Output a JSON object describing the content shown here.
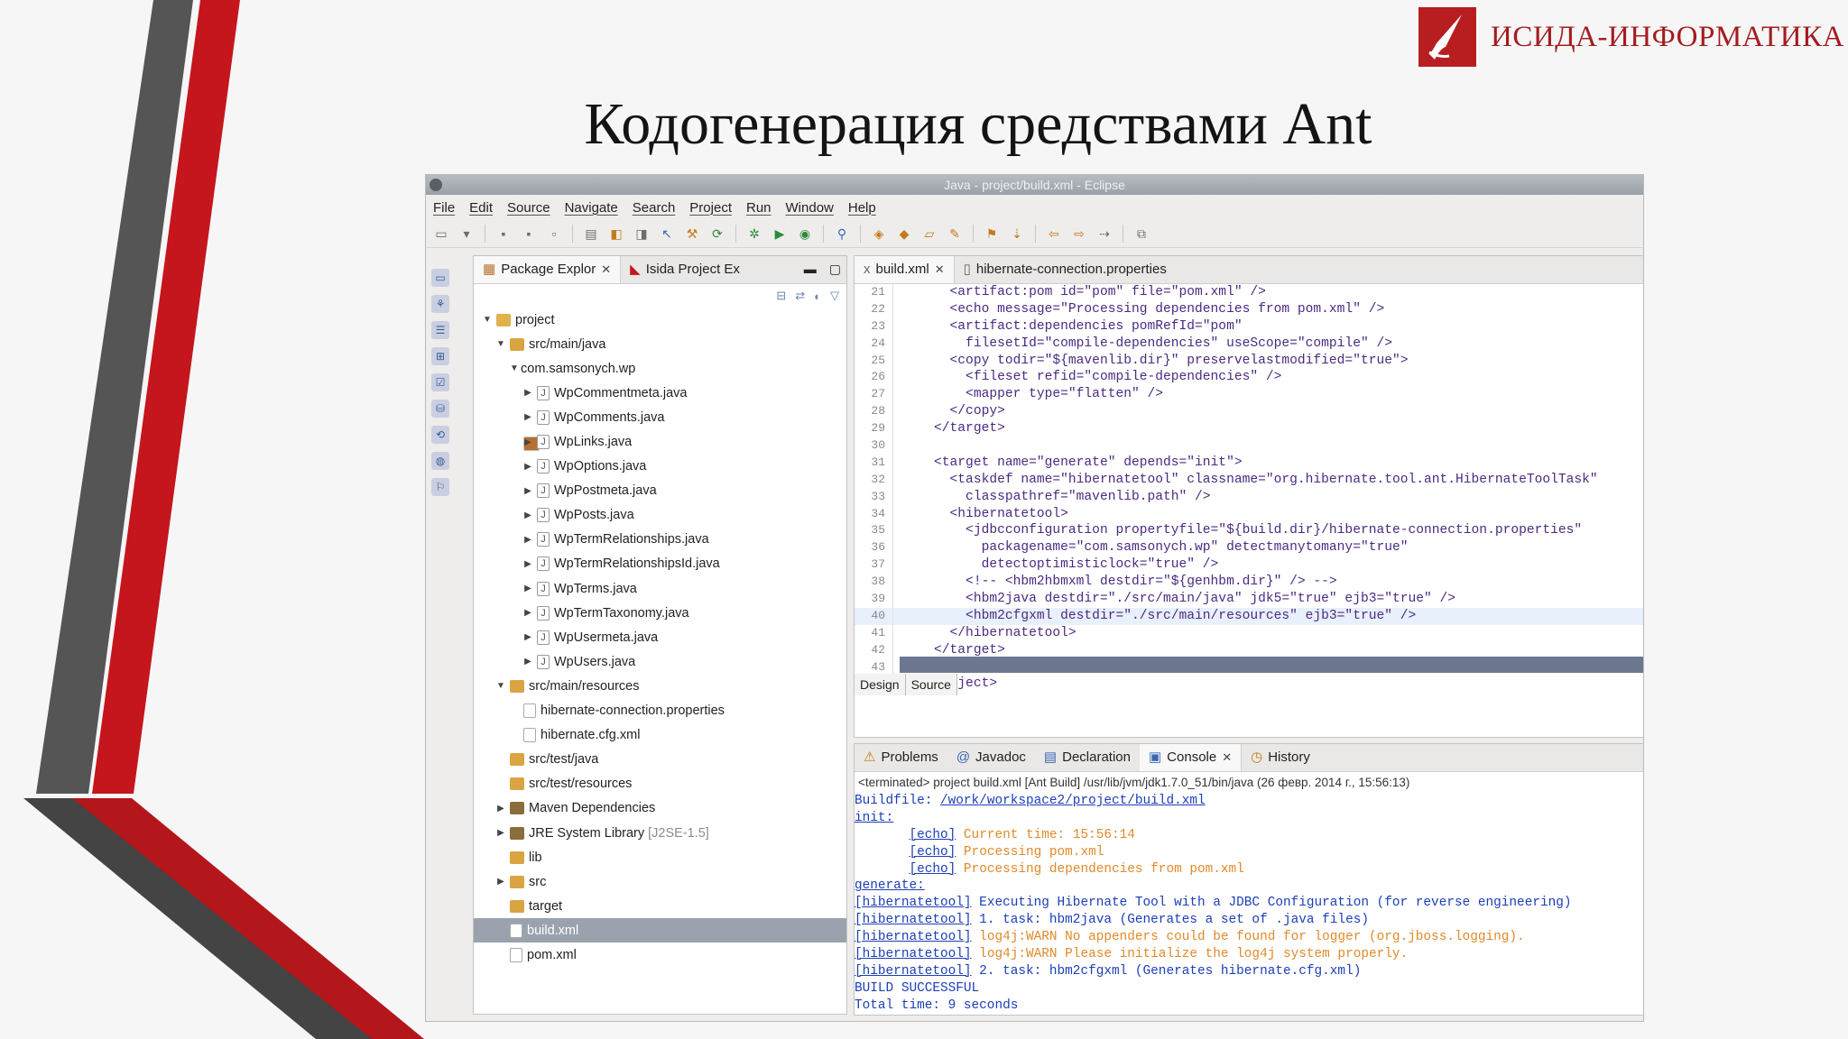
{
  "brand": {
    "name": "ИСИДА-ИНФОРМАТИКА",
    "color": "#a21d1f"
  },
  "slide": {
    "title": "Кодогенерация средствами Ant"
  },
  "window": {
    "title": "Java - project/build.xml - Eclipse",
    "menu": [
      "File",
      "Edit",
      "Source",
      "Navigate",
      "Search",
      "Project",
      "Run",
      "Window",
      "Help"
    ]
  },
  "package_explorer": {
    "tabs": [
      "Package Explor",
      "Isida Project Ex"
    ],
    "tree": [
      {
        "label": "project",
        "level": 0,
        "arrow": "▼",
        "icon": "project"
      },
      {
        "label": "src/main/java",
        "level": 1,
        "arrow": "▼",
        "icon": "folder"
      },
      {
        "label": "com.samsonych.wp",
        "level": 2,
        "arrow": "▼",
        "icon": "package"
      },
      {
        "label": "WpCommentmeta.java",
        "level": 3,
        "arrow": "▶",
        "icon": "java"
      },
      {
        "label": "WpComments.java",
        "level": 3,
        "arrow": "▶",
        "icon": "java"
      },
      {
        "label": "WpLinks.java",
        "level": 3,
        "arrow": "▶",
        "icon": "java"
      },
      {
        "label": "WpOptions.java",
        "level": 3,
        "arrow": "▶",
        "icon": "java"
      },
      {
        "label": "WpPostmeta.java",
        "level": 3,
        "arrow": "▶",
        "icon": "java"
      },
      {
        "label": "WpPosts.java",
        "level": 3,
        "arrow": "▶",
        "icon": "java"
      },
      {
        "label": "WpTermRelationships.java",
        "level": 3,
        "arrow": "▶",
        "icon": "java"
      },
      {
        "label": "WpTermRelationshipsId.java",
        "level": 3,
        "arrow": "▶",
        "icon": "java"
      },
      {
        "label": "WpTerms.java",
        "level": 3,
        "arrow": "▶",
        "icon": "java"
      },
      {
        "label": "WpTermTaxonomy.java",
        "level": 3,
        "arrow": "▶",
        "icon": "java"
      },
      {
        "label": "WpUsermeta.java",
        "level": 3,
        "arrow": "▶",
        "icon": "java"
      },
      {
        "label": "WpUsers.java",
        "level": 3,
        "arrow": "▶",
        "icon": "java"
      },
      {
        "label": "src/main/resources",
        "level": 1,
        "arrow": "▼",
        "icon": "folder"
      },
      {
        "label": "hibernate-connection.properties",
        "level": 2,
        "arrow": "",
        "icon": "file"
      },
      {
        "label": "hibernate.cfg.xml",
        "level": 2,
        "arrow": "",
        "icon": "file"
      },
      {
        "label": "src/test/java",
        "level": 1,
        "arrow": "",
        "icon": "folder"
      },
      {
        "label": "src/test/resources",
        "level": 1,
        "arrow": "",
        "icon": "folder"
      },
      {
        "label": "Maven Dependencies",
        "level": 1,
        "arrow": "▶",
        "icon": "lib"
      },
      {
        "label": "JRE System Library",
        "suffix": "[J2SE-1.5]",
        "level": 1,
        "arrow": "▶",
        "icon": "lib"
      },
      {
        "label": "lib",
        "level": 1,
        "arrow": "",
        "icon": "folder"
      },
      {
        "label": "src",
        "level": 1,
        "arrow": "▶",
        "icon": "folder"
      },
      {
        "label": "target",
        "level": 1,
        "arrow": "",
        "icon": "folder"
      },
      {
        "label": "build.xml",
        "level": 1,
        "arrow": "",
        "icon": "file",
        "selected": true
      },
      {
        "label": "pom.xml",
        "level": 1,
        "arrow": "",
        "icon": "file"
      }
    ]
  },
  "editor": {
    "tabs": [
      "build.xml",
      "hibernate-connection.properties"
    ],
    "bottom_tabs": [
      "Design",
      "Source"
    ],
    "lines": [
      {
        "n": "21",
        "text": "      <artifact:pom id=\"pom\" file=\"pom.xml\" />"
      },
      {
        "n": "22",
        "text": "      <echo message=\"Processing dependencies from pom.xml\" />"
      },
      {
        "n": "23",
        "text": "      <artifact:dependencies pomRefId=\"pom\""
      },
      {
        "n": "24",
        "text": "        filesetId=\"compile-dependencies\" useScope=\"compile\" />"
      },
      {
        "n": "25",
        "text": "      <copy todir=\"${mavenlib.dir}\" preservelastmodified=\"true\">"
      },
      {
        "n": "26",
        "text": "        <fileset refid=\"compile-dependencies\" />"
      },
      {
        "n": "27",
        "text": "        <mapper type=\"flatten\" />"
      },
      {
        "n": "28",
        "text": "      </copy>"
      },
      {
        "n": "29",
        "text": "    </target>"
      },
      {
        "n": "30",
        "text": ""
      },
      {
        "n": "31",
        "text": "    <target name=\"generate\" depends=\"init\">"
      },
      {
        "n": "32",
        "text": "      <taskdef name=\"hibernatetool\" classname=\"org.hibernate.tool.ant.HibernateToolTask\""
      },
      {
        "n": "33",
        "text": "        classpathref=\"mavenlib.path\" />"
      },
      {
        "n": "34",
        "text": "      <hibernatetool>"
      },
      {
        "n": "35",
        "text": "        <jdbcconfiguration propertyfile=\"${build.dir}/hibernate-connection.properties\""
      },
      {
        "n": "36",
        "text": "          packagename=\"com.samsonych.wp\" detectmanytomany=\"true\""
      },
      {
        "n": "37",
        "text": "          detectoptimisticlock=\"true\" />"
      },
      {
        "n": "38",
        "text": "        <!-- <hbm2hbmxml destdir=\"${genhbm.dir}\" /> -->"
      },
      {
        "n": "39",
        "text": "        <hbm2java destdir=\"./src/main/java\" jdk5=\"true\" ejb3=\"true\" />"
      },
      {
        "n": "40",
        "text": "        <hbm2cfgxml destdir=\"./src/main/resources\" ejb3=\"true\" />"
      },
      {
        "n": "41",
        "text": "      </hibernatetool>"
      },
      {
        "n": "42",
        "text": "    </target>"
      },
      {
        "n": "43",
        "text": ""
      },
      {
        "n": "44",
        "text": "  </project>"
      }
    ]
  },
  "console": {
    "tabs": [
      "Problems",
      "Javadoc",
      "Declaration",
      "Console",
      "History"
    ],
    "terminated": "<terminated> project build.xml [Ant Build] /usr/lib/jvm/jdk1.7.0_51/bin/java (26 февр. 2014 г., 15:56:13)",
    "lines": [
      {
        "prefix": "Buildfile: ",
        "link": "/work/workspace2/project/build.xml",
        "text": "",
        "color": "blue"
      },
      {
        "prefix": "",
        "link": "init:",
        "text": "",
        "color": "blue"
      },
      {
        "prefix": "       ",
        "link": "[echo]",
        "text": " Current time: 15:56:14",
        "color": "orange"
      },
      {
        "prefix": "       ",
        "link": "[echo]",
        "text": " Processing pom.xml",
        "color": "orange"
      },
      {
        "prefix": "       ",
        "link": "[echo]",
        "text": " Processing dependencies from pom.xml",
        "color": "orange"
      },
      {
        "prefix": "",
        "link": "generate:",
        "text": "",
        "color": "blue"
      },
      {
        "prefix": "",
        "link": "[hibernatetool]",
        "text": " Executing Hibernate Tool with a JDBC Configuration (for reverse engineering)",
        "color": "blue"
      },
      {
        "prefix": "",
        "link": "[hibernatetool]",
        "text": " 1. task: hbm2java (Generates a set of .java files)",
        "color": "blue"
      },
      {
        "prefix": "",
        "link": "[hibernatetool]",
        "text": " log4j:WARN No appenders could be found for logger (org.jboss.logging).",
        "color": "orange"
      },
      {
        "prefix": "",
        "link": "[hibernatetool]",
        "text": " log4j:WARN Please initialize the log4j system properly.",
        "color": "orange"
      },
      {
        "prefix": "",
        "link": "[hibernatetool]",
        "text": " 2. task: hbm2cfgxml (Generates hibernate.cfg.xml)",
        "color": "blue"
      },
      {
        "prefix": "",
        "link": "",
        "text": "BUILD SUCCESSFUL",
        "color": "blue"
      },
      {
        "prefix": "",
        "link": "",
        "text": "Total time: 9 seconds",
        "color": "blue"
      }
    ]
  }
}
